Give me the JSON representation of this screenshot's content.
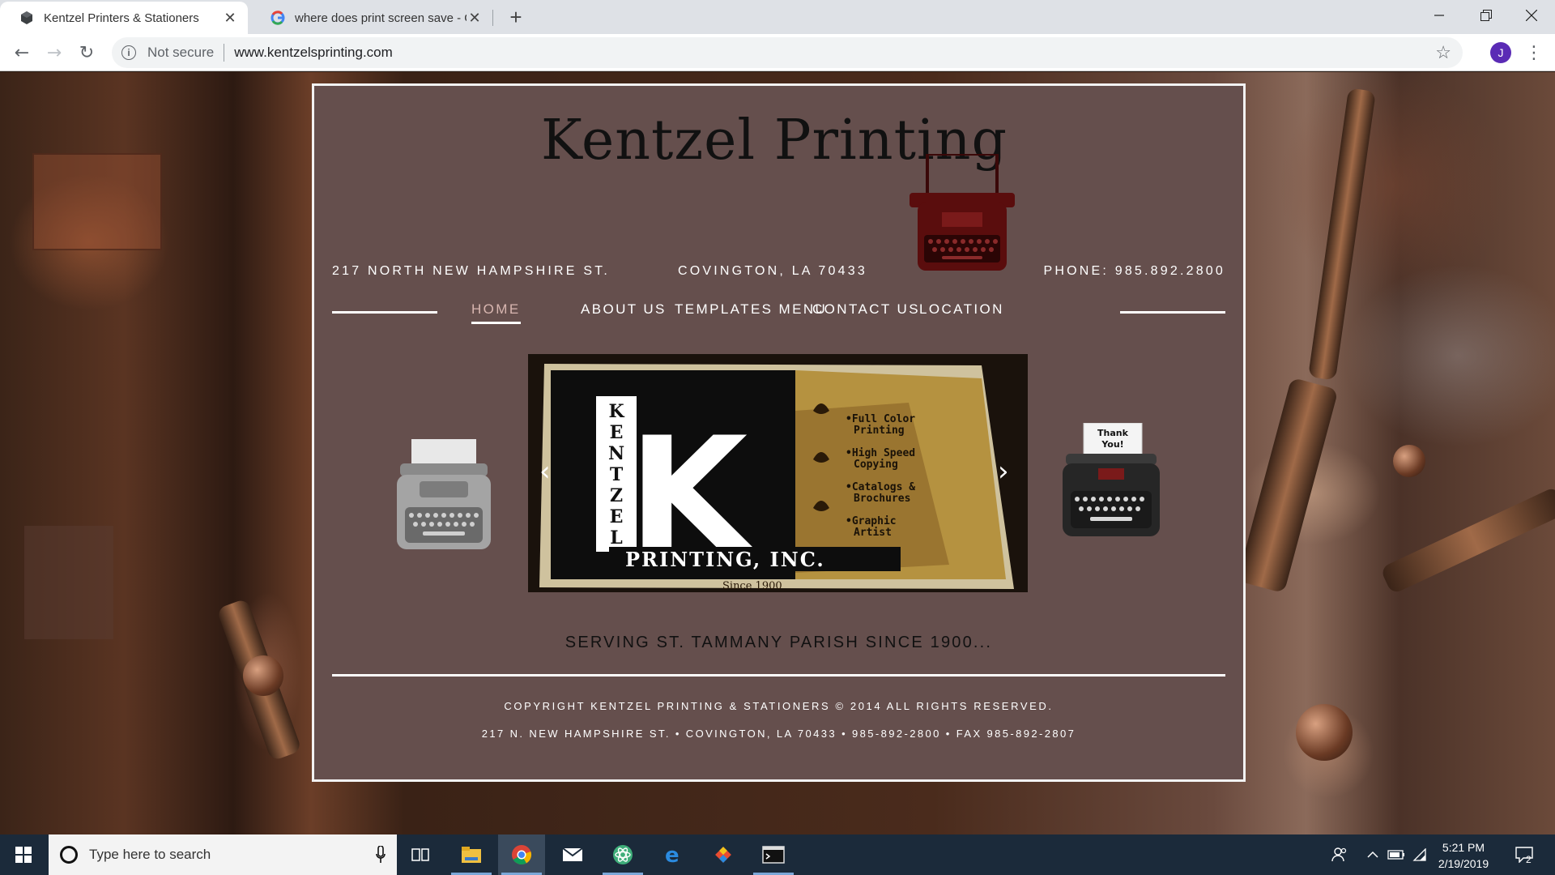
{
  "browser": {
    "tabs": [
      {
        "title": "Kentzel Printers & Stationers",
        "active": true,
        "favicon": "cube-favicon-icon"
      },
      {
        "title": "where does print screen save - G",
        "active": false,
        "favicon": "google-g-icon"
      }
    ],
    "address": {
      "security_label": "Not secure",
      "url": "www.kentzelsprinting.com"
    },
    "profile_initial": "J"
  },
  "site": {
    "title": "Kentzel Printing",
    "address_line": {
      "street": "217 NORTH NEW HAMPSHIRE ST.",
      "city": "COVINGTON, LA 70433",
      "phone": "PHONE: 985.892.2800"
    },
    "nav": [
      {
        "label": "HOME",
        "active": true
      },
      {
        "label": "ABOUT US",
        "active": false
      },
      {
        "label": "TEMPLATES MENU",
        "active": false
      },
      {
        "label": "CONTACT US",
        "active": false
      },
      {
        "label": "LOCATION",
        "active": false
      }
    ],
    "slide": {
      "letters": [
        "K",
        "E",
        "N",
        "T",
        "Z",
        "E",
        "L"
      ],
      "big_letter": "K",
      "bullets": [
        "•Full Color",
        "Printing",
        "•High Speed",
        "Copying",
        "•Catalogs &",
        "Brochures",
        "•Graphic",
        "Artist"
      ],
      "company": "PRINTING, INC.",
      "since": "Since 1900"
    },
    "thank_you_card": [
      "Thank",
      "You!"
    ],
    "tagline": "SERVING ST. TAMMANY PARISH SINCE 1900...",
    "copyright": "COPYRIGHT KENTZEL PRINTING & STATIONERS © 2014 ALL RIGHTS RESERVED.",
    "contact_line": "217 N. NEW HAMPSHIRE ST. • COVINGTON, LA 70433 • 985-892-2800 • FAX 985-892-2807"
  },
  "taskbar": {
    "search_placeholder": "Type here to search",
    "time": "5:21 PM",
    "date": "2/19/2019",
    "notification_count": "2"
  }
}
